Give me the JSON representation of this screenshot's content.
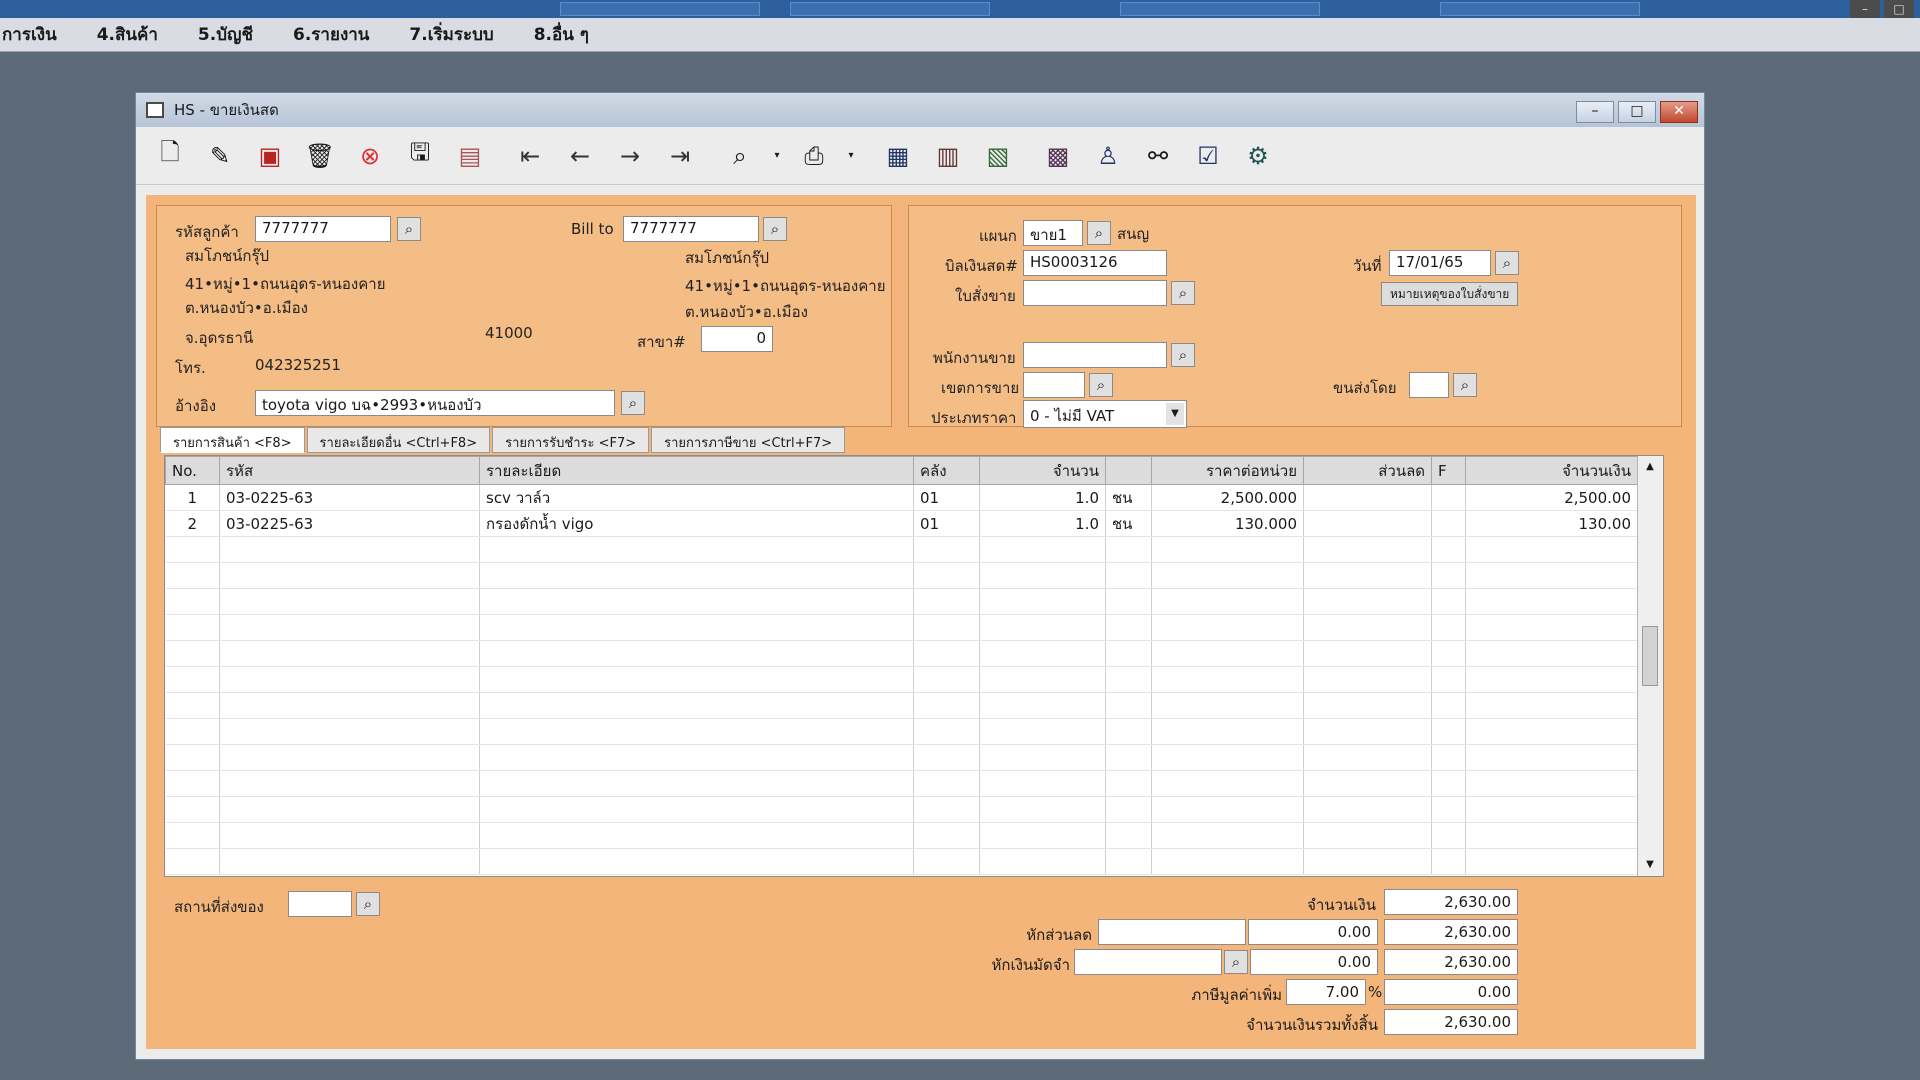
{
  "menu": [
    "การเงิน",
    "4.สินค้า",
    "5.บัญชี",
    "6.รายงาน",
    "7.เริ่มระบบ",
    "8.อื่น ๆ"
  ],
  "window": {
    "title": "HS - ขายเงินสด",
    "minimize": "–",
    "maximize": "□",
    "close": "✕"
  },
  "customer": {
    "code_label": "รหัสลูกค้า",
    "code": "7777777",
    "name": "สมโภชน์กรุ๊ป",
    "addr1": "41•หมู่•1•ถนนอุดร-หนองคาย",
    "addr2": "ต.หนองบัว•อ.เมือง",
    "province": "จ.อุดรธานี",
    "zip": "41000",
    "phone_label": "โทร.",
    "phone": "042325251",
    "ref_label": "อ้างอิง",
    "ref": "toyota vigo บฉ•2993•หนองบัว"
  },
  "billto": {
    "label": "Bill to",
    "code": "7777777",
    "name": "สมโภชน์กรุ๊ป",
    "addr1": "41•หมู่•1•ถนนอุดร-หนองคาย",
    "addr2": "ต.หนองบัว•อ.เมือง",
    "branch_label": "สาขา#",
    "branch": "0"
  },
  "doc": {
    "dept_label": "แผนก",
    "dept": "ขาย1",
    "dept_name": "สนญ",
    "bill_label": "บิลเงินสด#",
    "bill": "HS0003126",
    "date_label": "วันที่",
    "date": "17/01/65",
    "order_label": "ใบสั่งขาย",
    "order": "",
    "note_button": "หมายเหตุของใบสั่งขาย",
    "salesman_label": "พนักงานขาย",
    "salesman": "",
    "area_label": "เขตการขาย",
    "area": "",
    "ship_by_label": "ขนส่งโดย",
    "ship_by": "",
    "price_type_label": "ประเภทราคา",
    "price_type": "0 - ไม่มี VAT"
  },
  "tabs": [
    "รายการสินค้า <F8>",
    "รายละเอียดอื่น <Ctrl+F8>",
    "รายการรับชำระ <F7>",
    "รายการภาษีขาย <Ctrl+F7>"
  ],
  "columns": [
    "No.",
    "รหัส",
    "รายละเอียด",
    "คลัง",
    "จำนวน",
    "",
    "ราคาต่อหน่วย",
    "ส่วนลด",
    "F",
    "จำนวนเงิน"
  ],
  "rows": [
    {
      "no": "1",
      "code": "03-0225-63",
      "desc": "scv วาล์ว",
      "wh": "01",
      "qty": "1.0",
      "unit": "ชน",
      "price": "2,500.000",
      "disc": "",
      "f": "",
      "amount": "2,500.00"
    },
    {
      "no": "2",
      "code": "03-0225-63",
      "desc": "กรองดักน้ำ vigo",
      "wh": "01",
      "qty": "1.0",
      "unit": "ชน",
      "price": "130.000",
      "disc": "",
      "f": "",
      "amount": "130.00"
    }
  ],
  "bottom": {
    "ship_place_label": "สถานที่ส่งของ",
    "ship_place": "",
    "amount_label": "จำนวนเงิน",
    "amount": "2,630.00",
    "discount_label": "หักส่วนลด",
    "discount_input": "",
    "discount_value": "0.00",
    "after_discount": "2,630.00",
    "deposit_label": "หักเงินมัดจำ",
    "deposit_input": "",
    "deposit_value": "0.00",
    "after_deposit": "2,630.00",
    "vat_label": "ภาษีมูลค่าเพิ่ม",
    "vat_rate": "7.00",
    "vat_unit": "%",
    "vat_amount": "0.00",
    "grand_total_label": "จำนวนเงินรวมทั้งสิ้น",
    "grand_total": "2,630.00"
  },
  "toolbar_icons": [
    "new-document-icon",
    "edit-icon",
    "void-icon",
    "delete-icon",
    "cancel-icon",
    "save-icon",
    "attach-icon",
    "first-record-icon",
    "previous-record-icon",
    "next-record-icon",
    "last-record-icon",
    "search-document-icon",
    "print-icon",
    "export-icon",
    "form-icon",
    "report-icon",
    "calendar-icon",
    "approve-icon",
    "link-icon",
    "confirm-icon",
    "settings-icon"
  ]
}
